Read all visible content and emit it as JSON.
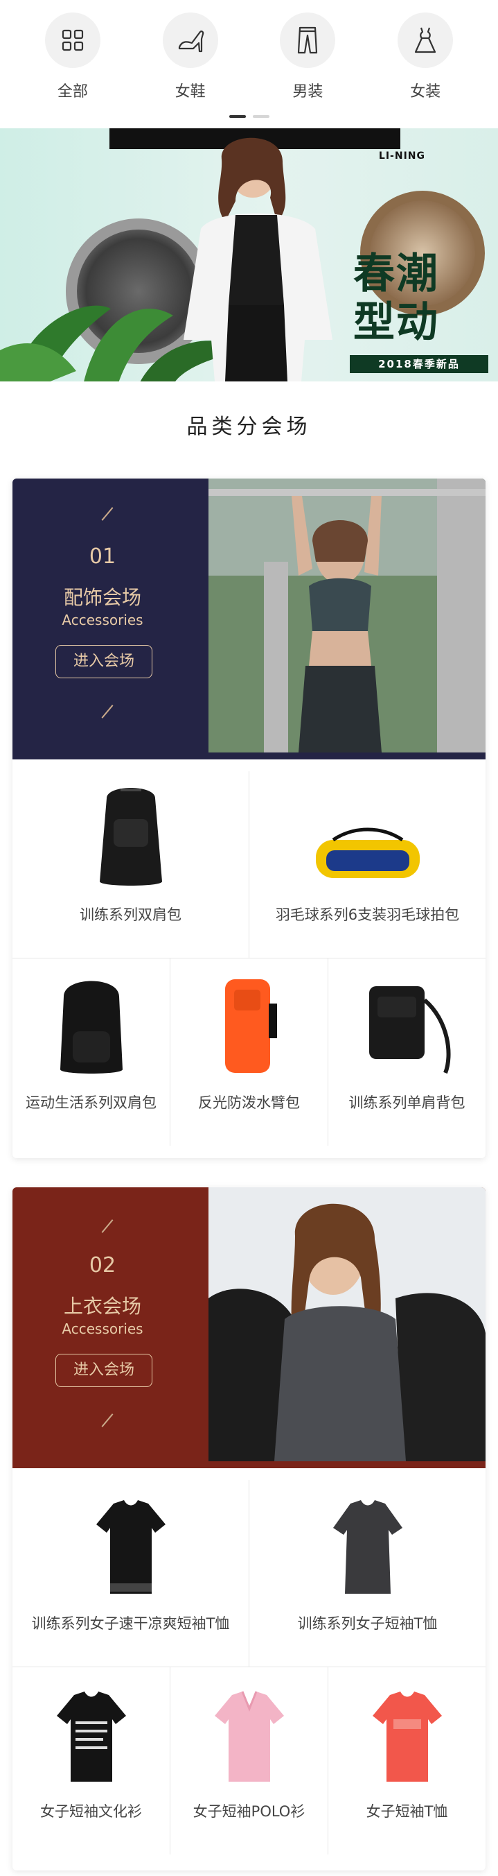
{
  "categories": [
    {
      "label": "全部",
      "icon": "grid-icon"
    },
    {
      "label": "女鞋",
      "icon": "high-heel-icon"
    },
    {
      "label": "男装",
      "icon": "trousers-icon"
    },
    {
      "label": "女装",
      "icon": "dress-icon"
    }
  ],
  "banner": {
    "brand": "LI-NING",
    "headline_line1": "春潮",
    "headline_line2": "型动",
    "tag": "2018春季新品"
  },
  "section_title": "品类分会场",
  "venues": [
    {
      "number": "01",
      "name": "配饰会场",
      "name_en": "Accessories",
      "button": "进入会场",
      "products": [
        {
          "name": "训练系列双肩包"
        },
        {
          "name": "羽毛球系列6支装羽毛球拍包"
        },
        {
          "name": "运动生活系列双肩包"
        },
        {
          "name": "反光防泼水臂包"
        },
        {
          "name": "训练系列单肩背包"
        }
      ]
    },
    {
      "number": "02",
      "name": "上衣会场",
      "name_en": "Accessories",
      "button": "进入会场",
      "products": [
        {
          "name": "训练系列女子速干凉爽短袖T恤"
        },
        {
          "name": "训练系列女子短袖T恤"
        },
        {
          "name": "女子短袖文化衫"
        },
        {
          "name": "女子短袖POLO衫"
        },
        {
          "name": "女子短袖T恤"
        }
      ]
    }
  ],
  "colors": {
    "venue1_bg": "#242445",
    "venue2_bg": "#7a2419",
    "accent_gold": "#e6c9a6"
  }
}
